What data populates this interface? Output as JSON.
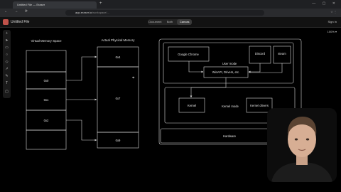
{
  "browser": {
    "tab_title": "Untitled File — Eraser",
    "new_tab": "+",
    "url_host": "app.eraser.io",
    "url_path": "/workspace/…",
    "nav": "← → ⟳",
    "window_controls": "— ▢ ✕",
    "extensions": "☆ ⋮"
  },
  "app": {
    "file_title": "Untitled File",
    "view_tabs": [
      "Document",
      "Both",
      "Canvas"
    ],
    "active_view": "Canvas",
    "signin": "Sign In",
    "zoom": "100% ▾"
  },
  "toolbar_icons": [
    "plus-icon",
    "cursor-icon",
    "rectangle-icon",
    "ellipse-icon",
    "diamond-icon",
    "arrow-icon",
    "pen-icon",
    "text-icon",
    "note-icon"
  ],
  "diagram": {
    "virtual_title": "Virtual Memory Space",
    "physical_title": "Actual Physical Memory",
    "virtual_pages": [
      "0x0",
      "0x1",
      "0x2"
    ],
    "physical_frames": [
      "0x4",
      "0x7",
      "0x9"
    ],
    "user_mode_label": "User mode",
    "kernel_mode_label": "Kernel mode",
    "user_apps": [
      "Google Chrome",
      "Discord",
      "steam"
    ],
    "winapi": "WinAPI, Drivers, etc.",
    "kernel": "Kernel",
    "kernel_drivers": "Kernel drivers",
    "hardware": "Hardware"
  },
  "colors": {
    "canvas_bg": "#000000",
    "stroke": "#d9d9d9",
    "brand": "#c0524a"
  }
}
